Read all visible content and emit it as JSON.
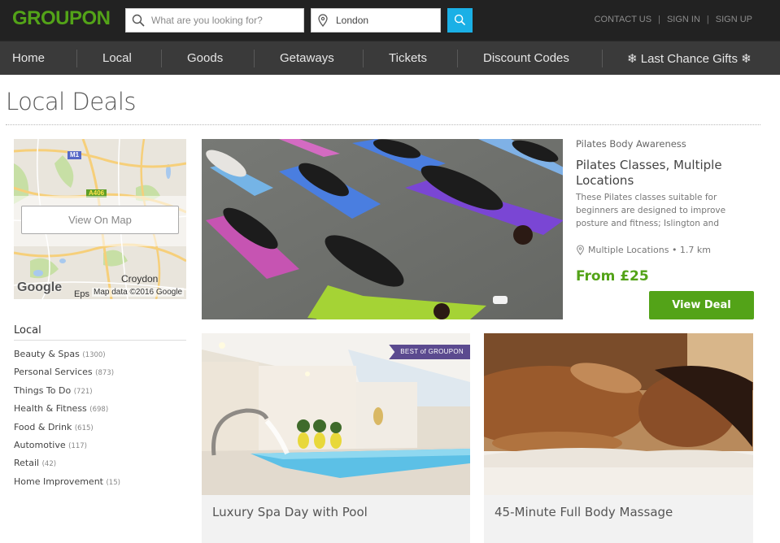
{
  "header": {
    "logo": "GROUPON",
    "search": {
      "placeholder": "What are you looking for?",
      "icon": "search-icon"
    },
    "location": {
      "value": "London",
      "icon": "location-pin-icon"
    },
    "search_button_icon": "search-icon",
    "links": [
      "CONTACT US",
      "SIGN IN",
      "SIGN UP"
    ]
  },
  "nav": {
    "items": [
      "Home",
      "Local",
      "Goods",
      "Getaways",
      "Tickets",
      "Discount Codes",
      "❄ Last Chance Gifts ❄"
    ]
  },
  "page": {
    "title": "Local Deals"
  },
  "map": {
    "button": "View On Map",
    "labels": {
      "croydon": "Croydon",
      "eps": "Eps",
      "road_m1": "M1",
      "road_a406": "A406"
    },
    "google": "Google",
    "attribution": "Map data ©2016 Google"
  },
  "categories": {
    "title": "Local",
    "items": [
      {
        "label": "Beauty & Spas",
        "count": "(1300)"
      },
      {
        "label": "Personal Services",
        "count": "(873)"
      },
      {
        "label": "Things To Do",
        "count": "(721)"
      },
      {
        "label": "Health & Fitness",
        "count": "(698)"
      },
      {
        "label": "Food & Drink",
        "count": "(615)"
      },
      {
        "label": "Automotive",
        "count": "(117)"
      },
      {
        "label": "Retail",
        "count": "(42)"
      },
      {
        "label": "Home Improvement",
        "count": "(15)"
      }
    ]
  },
  "featured": {
    "merchant": "Pilates Body Awareness",
    "title": "Pilates Classes, Multiple Locations",
    "description": "These Pilates classes suitable for beginners are designed to improve posture and fitness; Islington and",
    "location": "Multiple Locations • 1.7 km",
    "price": "From £25",
    "button": "View Deal",
    "image_alt": "Pilates class on yoga mats"
  },
  "cards": [
    {
      "title": "Luxury Spa Day with Pool",
      "badge": "BEST of GROUPON",
      "image_alt": "Indoor spa pool"
    },
    {
      "title": "45-Minute Full Body Massage",
      "image_alt": "Woman receiving back massage"
    }
  ],
  "colors": {
    "brand_green": "#53a318",
    "header_bg": "#222222",
    "nav_bg": "#3a3a3a",
    "search_button": "#1ab0e6",
    "badge_purple": "#5b4a8f"
  }
}
